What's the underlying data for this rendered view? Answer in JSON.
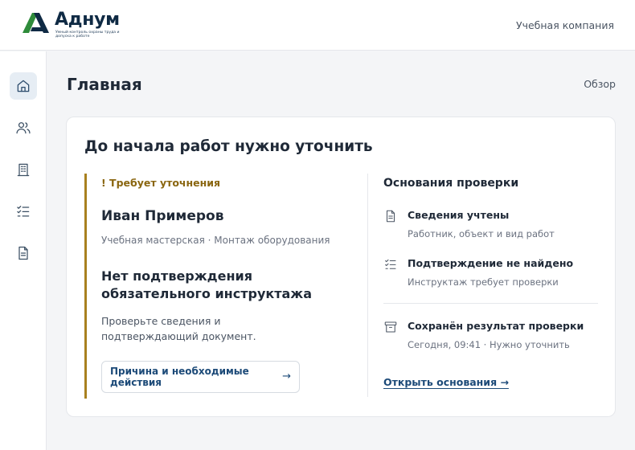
{
  "header": {
    "logo_text": "Аднум",
    "logo_tagline": "Умный контроль охраны труда и допуска к работе",
    "company": "Учебная компания",
    "colors": {
      "brand_green": "#2e8b3a",
      "brand_navy": "#0f2a44"
    }
  },
  "sidebar": {
    "items": [
      {
        "icon": "home-icon",
        "active": true
      },
      {
        "icon": "users-icon",
        "active": false
      },
      {
        "icon": "building-icon",
        "active": false
      },
      {
        "icon": "checklist-icon",
        "active": false
      },
      {
        "icon": "document-icon",
        "active": false
      }
    ]
  },
  "main": {
    "title": "Главная",
    "overview_link": "Обзор"
  },
  "card": {
    "title": "До начала работ нужно уточнить",
    "status_badge": "! Требует уточнения",
    "person_name": "Иван Примеров",
    "person_meta": "Учебная мастерская · Монтаж оборудования",
    "issue_title": "Нет подтверждения обязательного инструктажа",
    "issue_desc": "Проверьте сведения и подтверждающий документ.",
    "action_label": "Причина и необходимые действия",
    "action_arrow": "→",
    "accent_color": "#a8801f",
    "basis": {
      "title": "Основания проверки",
      "items": [
        {
          "icon": "document-icon",
          "title": "Сведения учтены",
          "sub": "Работник, объект и вид работ"
        },
        {
          "icon": "checklist-icon",
          "title": "Подтверждение не найдено",
          "sub": "Инструктаж требует проверки"
        },
        {
          "icon": "archive-icon",
          "title": "Сохранён результат проверки",
          "sub": "Сегодня, 09:41 · Нужно уточнить"
        }
      ],
      "open_link": "Открыть основания →"
    }
  }
}
